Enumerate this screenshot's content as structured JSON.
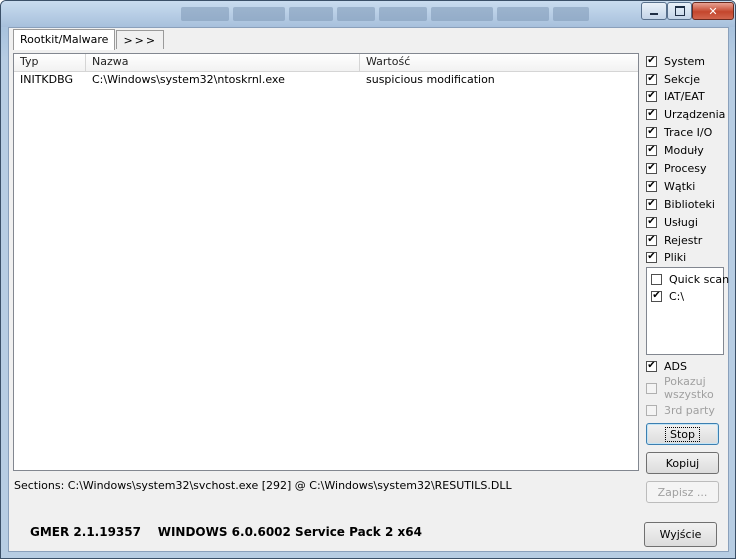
{
  "tabs": [
    {
      "label": "Rootkit/Malware"
    },
    {
      "label": ">>>"
    }
  ],
  "list": {
    "columns": [
      "Typ",
      "Nazwa",
      "Wartość"
    ],
    "rows": [
      {
        "typ": "INITKDBG",
        "nazwa": "C:\\Windows\\system32\\ntoskrnl.exe",
        "wartosc": "suspicious modification"
      }
    ]
  },
  "status_line": "Sections: C:\\Windows\\system32\\svchost.exe [292] @ C:\\Windows\\system32\\RESUTILS.DLL",
  "scan_options": [
    {
      "label": "System",
      "checked": true
    },
    {
      "label": "Sekcje",
      "checked": true
    },
    {
      "label": "IAT/EAT",
      "checked": true
    },
    {
      "label": "Urządzenia",
      "checked": true
    },
    {
      "label": "Trace I/O",
      "checked": true
    },
    {
      "label": "Moduły",
      "checked": true
    },
    {
      "label": "Procesy",
      "checked": true
    },
    {
      "label": "Wątki",
      "checked": true
    },
    {
      "label": "Biblioteki",
      "checked": true
    },
    {
      "label": "Usługi",
      "checked": true
    },
    {
      "label": "Rejestr",
      "checked": true
    },
    {
      "label": "Pliki",
      "checked": true
    }
  ],
  "scan_targets": [
    {
      "label": "Quick scan",
      "checked": false
    },
    {
      "label": "C:\\",
      "checked": true
    }
  ],
  "extra_options": {
    "ads": {
      "label": "ADS",
      "checked": true
    },
    "show_all": {
      "label_line1": "Pokazuj",
      "label_line2": "wszystko",
      "checked": false,
      "enabled": false
    },
    "third_party": {
      "label": "3rd party",
      "checked": false,
      "enabled": false
    }
  },
  "buttons": {
    "stop": "Stop",
    "copy": "Kopiuj",
    "save": "Zapisz ...",
    "exit": "Wyjście"
  },
  "footer": {
    "version": "GMER 2.1.19357",
    "os": "WINDOWS 6.0.6002 Service Pack 2 x64"
  },
  "check_glyph": "✔"
}
